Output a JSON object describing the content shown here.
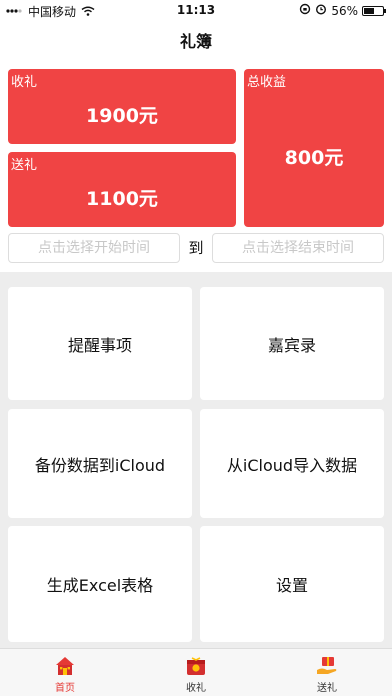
{
  "status_bar": {
    "carrier": "中国移动",
    "time": "11:13",
    "battery": "56%",
    "battery_level": 0.56
  },
  "nav": {
    "title": "礼簿"
  },
  "summary": {
    "receive_label": "收礼",
    "receive_value": "1900元",
    "send_label": "送礼",
    "send_value": "1100元",
    "total_label": "总收益",
    "total_value": "800元"
  },
  "date_range": {
    "start_placeholder": "点击选择开始时间",
    "separator": "到",
    "end_placeholder": "点击选择结束时间"
  },
  "tiles": [
    {
      "label": "提醒事项"
    },
    {
      "label": "嘉宾录"
    },
    {
      "label": "备份数据到iCloud"
    },
    {
      "label": "从iCloud导入数据"
    },
    {
      "label": "生成Excel表格"
    },
    {
      "label": "设置"
    }
  ],
  "tab_bar": {
    "items": [
      {
        "label": "首页",
        "icon": "home-icon"
      },
      {
        "label": "收礼",
        "icon": "gift-box-icon"
      },
      {
        "label": "送礼",
        "icon": "gift-hand-icon"
      }
    ],
    "active_color": "#e53935"
  },
  "colors": {
    "accent": "#f04444"
  }
}
